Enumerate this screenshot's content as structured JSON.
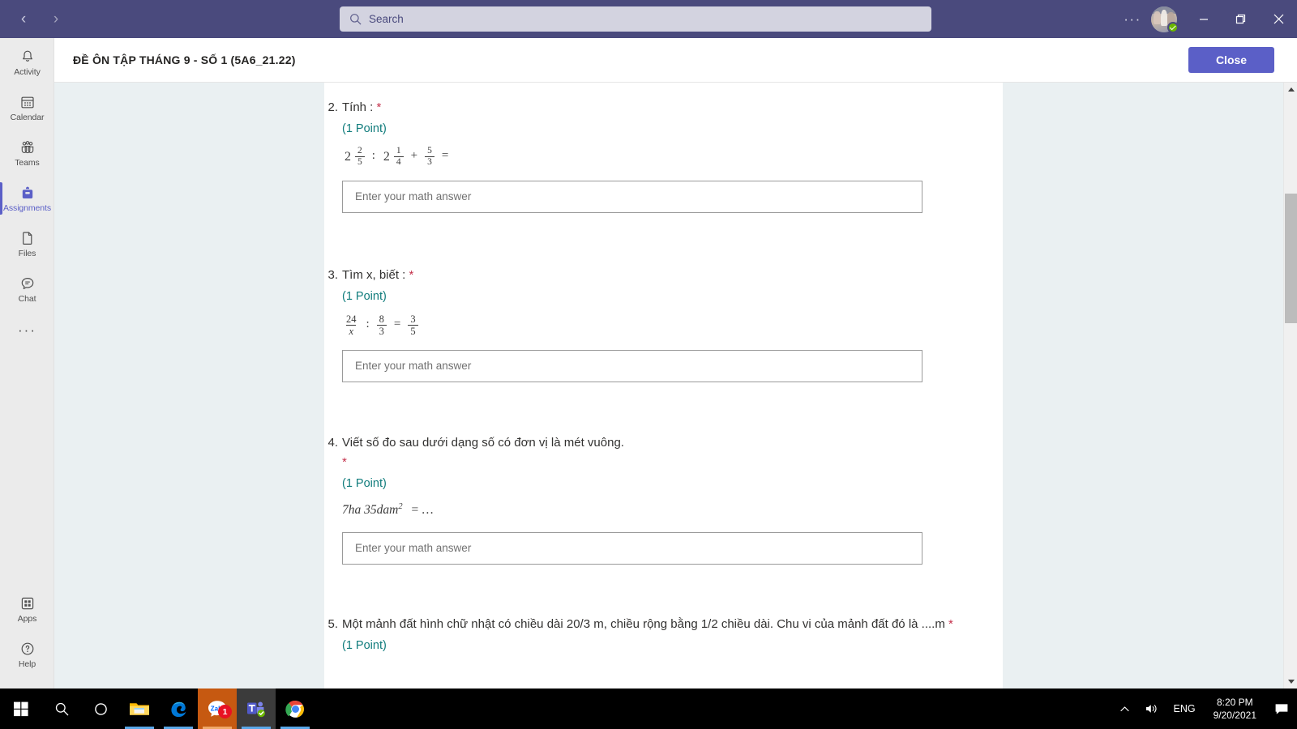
{
  "titlebar": {
    "back_icon": "chevron-left-icon",
    "forward_icon": "chevron-right-icon",
    "search_placeholder": "Search",
    "more_label": "···",
    "presence": "available",
    "minimize_label": "Minimize",
    "restore_label": "Restore",
    "close_label": "Close"
  },
  "rail": {
    "items": [
      {
        "label": "Activity",
        "icon": "bell-icon",
        "active": false
      },
      {
        "label": "Calendar",
        "icon": "calendar-icon",
        "active": false
      },
      {
        "label": "Teams",
        "icon": "teams-icon",
        "active": false
      },
      {
        "label": "Assignments",
        "icon": "backpack-icon",
        "active": true
      },
      {
        "label": "Files",
        "icon": "file-icon",
        "active": false
      },
      {
        "label": "Chat",
        "icon": "chat-icon",
        "active": false
      }
    ],
    "more_label": "···",
    "bottom": [
      {
        "label": "Apps",
        "icon": "apps-grid-icon"
      },
      {
        "label": "Help",
        "icon": "question-circle-icon"
      }
    ]
  },
  "assignment": {
    "title": "ĐỀ ÔN TẬP THÁNG 9 - SỐ 1 (5A6_21.22)",
    "close_button": "Close"
  },
  "form": {
    "answer_placeholder": "Enter your math answer",
    "required_mark": "*",
    "questions": [
      {
        "number": "2.",
        "text": "Tính :",
        "points": "(1 Point)",
        "math_type": "expr1",
        "math_plain": "2 2/5 : 2 1/4 + 5/3 =",
        "whole1": "2",
        "n1": "2",
        "d1": "5",
        "op1": ":",
        "whole2": "2",
        "n2": "1",
        "d2": "4",
        "op2": "+",
        "n3": "5",
        "d3": "3",
        "op3": "="
      },
      {
        "number": "3.",
        "text": "Tìm x, biết :",
        "points": "(1 Point)",
        "math_type": "expr2",
        "math_plain": "24/x : 8/3 = 3/5",
        "n1": "24",
        "d1": "x",
        "op1": ":",
        "n2": "8",
        "d2": "3",
        "op2": "=",
        "n3": "3",
        "d3": "5"
      },
      {
        "number": "4.",
        "text": "Viết số đo sau dưới dạng số có đơn vị là mét vuông.",
        "points": "(1 Point)",
        "math_type": "expr3",
        "math_plain": "7ha 35dam² = …",
        "base": "7ha 35dam",
        "sup": "2",
        "tail": "= …"
      },
      {
        "number": "5.",
        "text": "Một mảnh đất hình chữ nhật có chiều dài 20/3 m, chiều rộng bằng 1/2 chiều dài. Chu vi của mảnh đất đó là ....m",
        "points": "(1 Point)",
        "math_type": "none"
      }
    ]
  },
  "scrollbar": {
    "up_icon": "scroll-up-arrow",
    "down_icon": "scroll-down-arrow",
    "thumb_position_pct": 18
  },
  "taskbar": {
    "start_icon": "windows-start-icon",
    "search_icon": "search-icon",
    "cortana_icon": "cortana-circle-icon",
    "apps": [
      {
        "name": "file-explorer",
        "running": true,
        "badge": ""
      },
      {
        "name": "microsoft-edge",
        "running": true,
        "badge": ""
      },
      {
        "name": "zalo",
        "running": true,
        "badge": "1"
      },
      {
        "name": "microsoft-teams",
        "running": true,
        "badge": ""
      },
      {
        "name": "google-chrome",
        "running": true,
        "badge": ""
      }
    ],
    "tray": {
      "chevron_icon": "show-hidden-icons",
      "volume_icon": "volume-icon",
      "language": "ENG",
      "time": "8:20 PM",
      "date": "9/20/2021",
      "notification_icon": "action-center-icon"
    }
  },
  "colors": {
    "teams_purple": "#4a4a7d",
    "accent_purple": "#5b5fc7",
    "required_red": "#c4314b",
    "points_teal": "#107c7c",
    "workarea_bg": "#eaf0f2"
  }
}
